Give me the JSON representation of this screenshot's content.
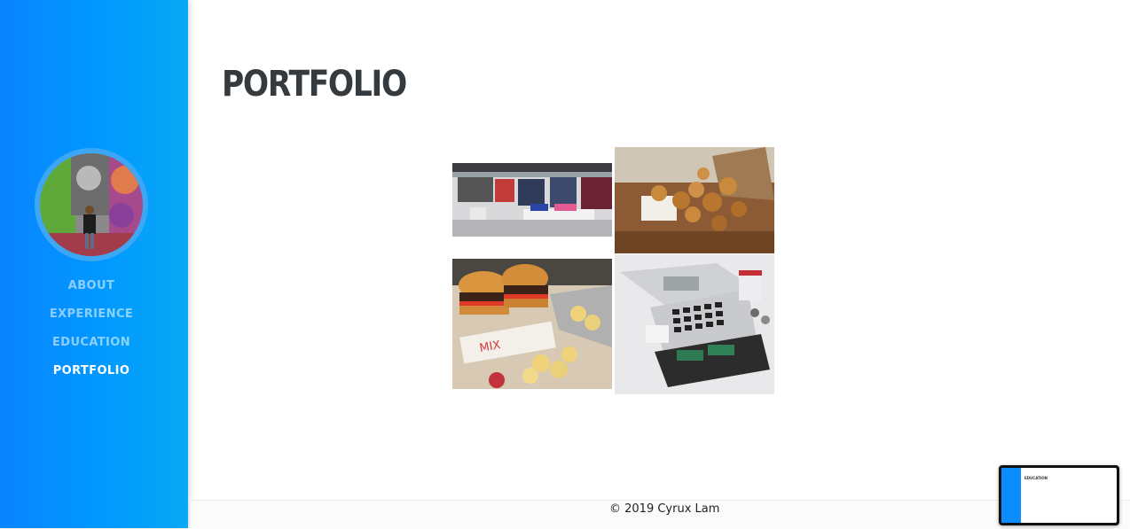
{
  "sidebar": {
    "avatar_alt": "profile photo",
    "nav": [
      {
        "label": "ABOUT",
        "active": false
      },
      {
        "label": "EXPERIENCE",
        "active": false
      },
      {
        "label": "EDUCATION",
        "active": false
      },
      {
        "label": "PORTFOLIO",
        "active": true
      }
    ]
  },
  "main": {
    "title": "PORTFOLIO",
    "portfolio": [
      {
        "subject": "clothing store"
      },
      {
        "subject": "fried chicken"
      },
      {
        "subject": "burgers and chips"
      },
      {
        "subject": "cash register"
      }
    ]
  },
  "footer": {
    "text": "© 2019 Cyrux Lam"
  },
  "preview": {
    "title": "EDUCATION"
  },
  "colors": {
    "sidebar": "#0a84ff",
    "title": "#353a3f",
    "nav_active": "#ffffff"
  }
}
